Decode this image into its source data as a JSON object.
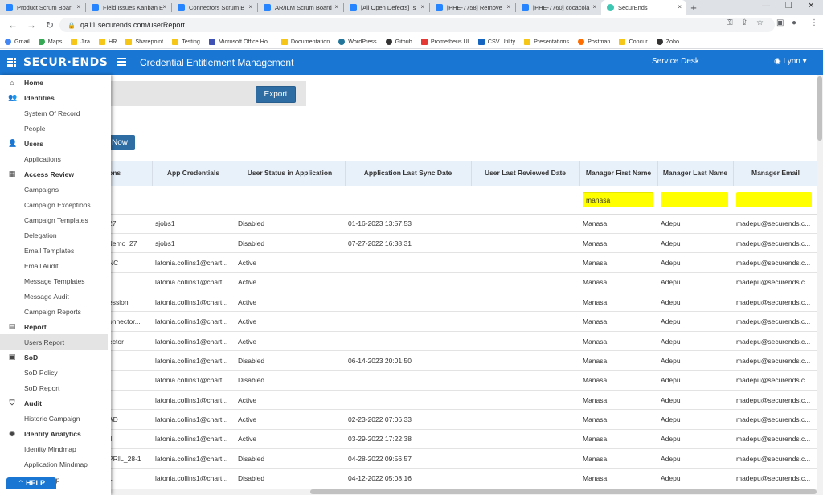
{
  "browser": {
    "tabs": [
      {
        "label": "Product Scrum Boar"
      },
      {
        "label": "Field Issues Kanban E"
      },
      {
        "label": "Connectors Scrum B"
      },
      {
        "label": "AR/ILM Scrum Board"
      },
      {
        "label": "[All Open Defects] Is"
      },
      {
        "label": "[PHE-7758] Remove"
      },
      {
        "label": "[PHE-7760] cocacola"
      },
      {
        "label": "SecurEnds"
      }
    ],
    "tab_close": "×",
    "new_tab": "+",
    "url": "qa11.securends.com/userReport",
    "bookmarks": [
      {
        "label": "Gmail",
        "icon": "g"
      },
      {
        "label": "Maps",
        "icon": "m"
      },
      {
        "label": "Jira",
        "icon": "folder"
      },
      {
        "label": "HR",
        "icon": "folder"
      },
      {
        "label": "Sharepoint",
        "icon": "folder"
      },
      {
        "label": "Testing",
        "icon": "folder"
      },
      {
        "label": "Microsoft Office Ho...",
        "icon": "doc"
      },
      {
        "label": "Documentation",
        "icon": "folder"
      },
      {
        "label": "WordPress",
        "icon": "w"
      },
      {
        "label": "Github",
        "icon": "b"
      },
      {
        "label": "Prometheus UI",
        "icon": "r"
      },
      {
        "label": "CSV Utility",
        "icon": "s"
      },
      {
        "label": "Presentations",
        "icon": "folder"
      },
      {
        "label": "Postman",
        "icon": "o"
      },
      {
        "label": "Concur",
        "icon": "folder"
      },
      {
        "label": "Zoho",
        "icon": "b"
      }
    ]
  },
  "header": {
    "logo": "SECUR·ENDS",
    "title": "Credential Entitlement Management",
    "service_desk": "Service Desk",
    "user": "◉ Lynn ▾"
  },
  "sidebar": {
    "items": [
      {
        "type": "sec",
        "label": "Home",
        "icon": "home"
      },
      {
        "type": "sec",
        "label": "Identities",
        "icon": "people"
      },
      {
        "type": "item",
        "label": "System Of Record"
      },
      {
        "type": "item",
        "label": "People"
      },
      {
        "type": "sec",
        "label": "Users",
        "icon": "user"
      },
      {
        "type": "item",
        "label": "Applications"
      },
      {
        "type": "sec",
        "label": "Access Review",
        "icon": "grid"
      },
      {
        "type": "item",
        "label": "Campaigns"
      },
      {
        "type": "item",
        "label": "Campaign Exceptions"
      },
      {
        "type": "item",
        "label": "Campaign Templates"
      },
      {
        "type": "item",
        "label": "Delegation"
      },
      {
        "type": "item",
        "label": "Email Templates"
      },
      {
        "type": "item",
        "label": "Email Audit"
      },
      {
        "type": "item",
        "label": "Message Templates"
      },
      {
        "type": "item",
        "label": "Message Audit"
      },
      {
        "type": "item",
        "label": "Campaign Reports"
      },
      {
        "type": "sec",
        "label": "Report",
        "icon": "report"
      },
      {
        "type": "item",
        "label": "Users Report",
        "active": true
      },
      {
        "type": "sec",
        "label": "SoD",
        "icon": "sod"
      },
      {
        "type": "item",
        "label": "SoD Policy"
      },
      {
        "type": "item",
        "label": "SoD Report"
      },
      {
        "type": "sec",
        "label": "Audit",
        "icon": "shield"
      },
      {
        "type": "item",
        "label": "Historic Campaign"
      },
      {
        "type": "sec",
        "label": "Identity Analytics",
        "icon": "analytics"
      },
      {
        "type": "item",
        "label": "Identity Mindmap"
      },
      {
        "type": "item",
        "label": "Application Mindmap"
      },
      {
        "type": "item",
        "label": "nt Mindmap"
      }
    ],
    "help": "⌃ HELP"
  },
  "actions": {
    "export_label": "Export",
    "now_label": "Now"
  },
  "table": {
    "columns": [
      "ons",
      "App Credentials",
      "User Status in Application",
      "Application Last Sync Date",
      "User Last Reviewed Date",
      "Manager First Name",
      "Manager Last Name",
      "Manager Email"
    ],
    "filters": {
      "manager_first_name": "manasa"
    },
    "rows": [
      [
        "27",
        "sjobs1",
        "Disabled",
        "01-16-2023 13:57:53",
        "",
        "Manasa",
        "Adepu",
        "madepu@securends.c..."
      ],
      [
        "demo_27",
        "sjobs1",
        "Disabled",
        "07-27-2022 16:38:31",
        "",
        "Manasa",
        "Adepu",
        "madepu@securends.c..."
      ],
      [
        "NC",
        "latonia.collins1@chart...",
        "Active",
        "",
        "",
        "Manasa",
        "Adepu",
        "madepu@securends.c..."
      ],
      [
        "",
        "latonia.collins1@chart...",
        "Active",
        "",
        "",
        "Manasa",
        "Adepu",
        "madepu@securends.c..."
      ],
      [
        "ession",
        "latonia.collins1@chart...",
        "Active",
        "",
        "",
        "Manasa",
        "Adepu",
        "madepu@securends.c..."
      ],
      [
        "onnector...",
        "latonia.collins1@chart...",
        "Active",
        "",
        "",
        "Manasa",
        "Adepu",
        "madepu@securends.c..."
      ],
      [
        "ector",
        "latonia.collins1@chart...",
        "Active",
        "",
        "",
        "Manasa",
        "Adepu",
        "madepu@securends.c..."
      ],
      [
        "",
        "latonia.collins1@chart...",
        "Disabled",
        "06-14-2023 20:01:50",
        "",
        "Manasa",
        "Adepu",
        "madepu@securends.c..."
      ],
      [
        "",
        "latonia.collins1@chart...",
        "Disabled",
        "",
        "",
        "Manasa",
        "Adepu",
        "madepu@securends.c..."
      ],
      [
        "",
        "latonia.collins1@chart...",
        "Active",
        "",
        "",
        "Manasa",
        "Adepu",
        "madepu@securends.c..."
      ],
      [
        "AD",
        "latonia.collins1@chart...",
        "Active",
        "02-23-2022 07:06:33",
        "",
        "Manasa",
        "Adepu",
        "madepu@securends.c..."
      ],
      [
        "4",
        "latonia.collins1@chart...",
        "Active",
        "03-29-2022 17:22:38",
        "",
        "Manasa",
        "Adepu",
        "madepu@securends.c..."
      ],
      [
        "PRIL_28-1",
        "latonia.collins1@chart...",
        "Disabled",
        "04-28-2022 09:56:57",
        "",
        "Manasa",
        "Adepu",
        "madepu@securends.c..."
      ],
      [
        "1",
        "latonia.collins1@chart...",
        "Disabled",
        "04-12-2022 05:08:16",
        "",
        "Manasa",
        "Adepu",
        "madepu@securends.c..."
      ]
    ]
  },
  "colors": {
    "brand": "#1976d2",
    "button": "#2e6da4",
    "highlight": "#ffff00"
  }
}
